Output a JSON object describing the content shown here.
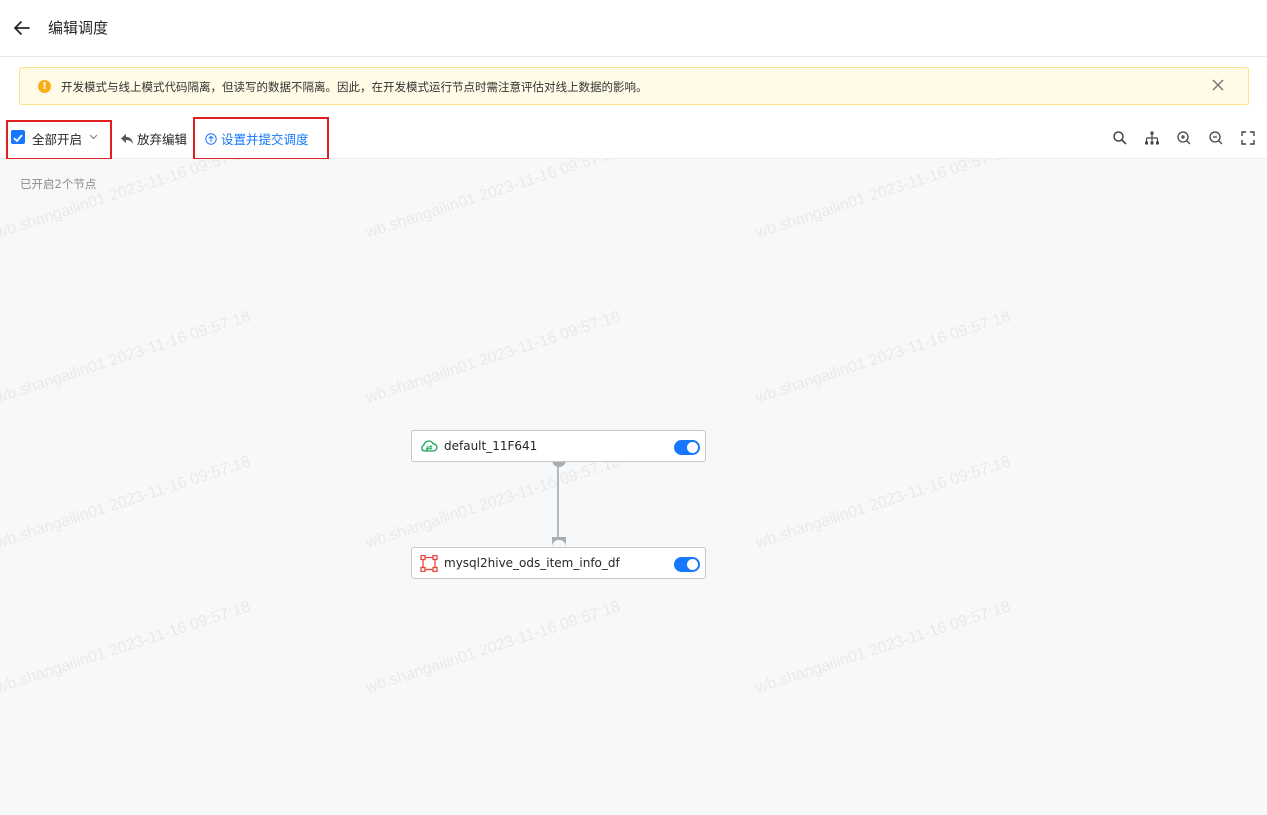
{
  "header": {
    "title": "编辑调度"
  },
  "alert": {
    "text": "开发模式与线上模式代码隔离，但读写的数据不隔离。因此，在开发模式运行节点时需注意评估对线上数据的影响。"
  },
  "toolbar": {
    "enable_all_label": "全部开启",
    "enable_all_checked": true,
    "discard_label": "放弃编辑",
    "submit_label": "设置并提交调度",
    "right_tools": [
      "search-icon",
      "layout-tree-icon",
      "zoom-in-icon",
      "zoom-out-icon",
      "fullscreen-icon"
    ]
  },
  "canvas": {
    "status": "已开启2个节点",
    "watermark": "wb.shangailin01 2023-11-16 09:57:18",
    "nodes": [
      {
        "name": "default_11F641",
        "icon": "cloud-sync-icon",
        "icon_color": "#18a058",
        "enabled": true
      },
      {
        "name": "mysql2hive_ods_item_info_df",
        "icon": "data-sync-icon",
        "icon_color": "#e8453c",
        "enabled": true
      }
    ]
  },
  "colors": {
    "accent": "#1677ff",
    "highlight_box": "#e02020",
    "alert_bg": "#fffbe6",
    "canvas_bg": "#f7f8fa"
  }
}
